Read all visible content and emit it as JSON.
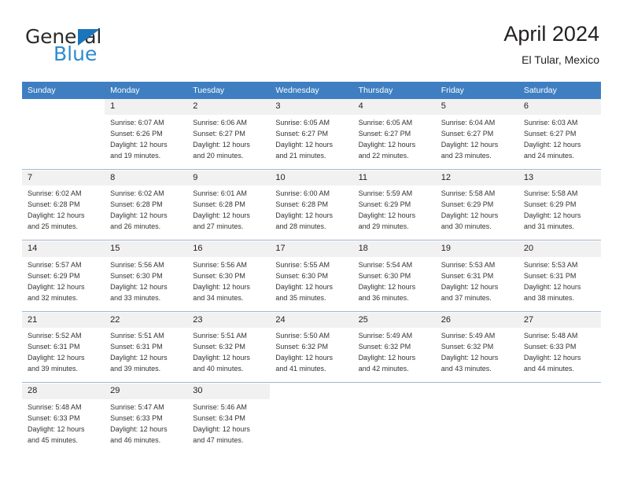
{
  "brand": {
    "name_part1": "General",
    "name_part2": "Blue",
    "accent_color": "#1b75bb",
    "accent_color_light": "#2e8bd0",
    "triangle_icon": "triangle-icon"
  },
  "header": {
    "title": "April 2024",
    "subtitle": "El Tular, Mexico"
  },
  "theme": {
    "header_row_bg": "#3f7fc1",
    "daynum_band_bg": "#f1f1f1",
    "separator_color": "#9fb6cd",
    "text_color": "#231f20"
  },
  "calendar": {
    "weekday_headers": [
      "Sunday",
      "Monday",
      "Tuesday",
      "Wednesday",
      "Thursday",
      "Friday",
      "Saturday"
    ],
    "labels": {
      "sunrise": "Sunrise:",
      "sunset": "Sunset:",
      "daylight": "Daylight:"
    },
    "weeks": [
      {
        "days": [
          {
            "num": "",
            "sunrise": "",
            "sunset": "",
            "daylight_line1": "",
            "daylight_line2": "",
            "empty": true
          },
          {
            "num": "1",
            "sunrise": "Sunrise: 6:07 AM",
            "sunset": "Sunset: 6:26 PM",
            "daylight_line1": "Daylight: 12 hours",
            "daylight_line2": "and 19 minutes."
          },
          {
            "num": "2",
            "sunrise": "Sunrise: 6:06 AM",
            "sunset": "Sunset: 6:27 PM",
            "daylight_line1": "Daylight: 12 hours",
            "daylight_line2": "and 20 minutes."
          },
          {
            "num": "3",
            "sunrise": "Sunrise: 6:05 AM",
            "sunset": "Sunset: 6:27 PM",
            "daylight_line1": "Daylight: 12 hours",
            "daylight_line2": "and 21 minutes."
          },
          {
            "num": "4",
            "sunrise": "Sunrise: 6:05 AM",
            "sunset": "Sunset: 6:27 PM",
            "daylight_line1": "Daylight: 12 hours",
            "daylight_line2": "and 22 minutes."
          },
          {
            "num": "5",
            "sunrise": "Sunrise: 6:04 AM",
            "sunset": "Sunset: 6:27 PM",
            "daylight_line1": "Daylight: 12 hours",
            "daylight_line2": "and 23 minutes."
          },
          {
            "num": "6",
            "sunrise": "Sunrise: 6:03 AM",
            "sunset": "Sunset: 6:27 PM",
            "daylight_line1": "Daylight: 12 hours",
            "daylight_line2": "and 24 minutes."
          }
        ]
      },
      {
        "days": [
          {
            "num": "7",
            "sunrise": "Sunrise: 6:02 AM",
            "sunset": "Sunset: 6:28 PM",
            "daylight_line1": "Daylight: 12 hours",
            "daylight_line2": "and 25 minutes."
          },
          {
            "num": "8",
            "sunrise": "Sunrise: 6:02 AM",
            "sunset": "Sunset: 6:28 PM",
            "daylight_line1": "Daylight: 12 hours",
            "daylight_line2": "and 26 minutes."
          },
          {
            "num": "9",
            "sunrise": "Sunrise: 6:01 AM",
            "sunset": "Sunset: 6:28 PM",
            "daylight_line1": "Daylight: 12 hours",
            "daylight_line2": "and 27 minutes."
          },
          {
            "num": "10",
            "sunrise": "Sunrise: 6:00 AM",
            "sunset": "Sunset: 6:28 PM",
            "daylight_line1": "Daylight: 12 hours",
            "daylight_line2": "and 28 minutes."
          },
          {
            "num": "11",
            "sunrise": "Sunrise: 5:59 AM",
            "sunset": "Sunset: 6:29 PM",
            "daylight_line1": "Daylight: 12 hours",
            "daylight_line2": "and 29 minutes."
          },
          {
            "num": "12",
            "sunrise": "Sunrise: 5:58 AM",
            "sunset": "Sunset: 6:29 PM",
            "daylight_line1": "Daylight: 12 hours",
            "daylight_line2": "and 30 minutes."
          },
          {
            "num": "13",
            "sunrise": "Sunrise: 5:58 AM",
            "sunset": "Sunset: 6:29 PM",
            "daylight_line1": "Daylight: 12 hours",
            "daylight_line2": "and 31 minutes."
          }
        ]
      },
      {
        "days": [
          {
            "num": "14",
            "sunrise": "Sunrise: 5:57 AM",
            "sunset": "Sunset: 6:29 PM",
            "daylight_line1": "Daylight: 12 hours",
            "daylight_line2": "and 32 minutes."
          },
          {
            "num": "15",
            "sunrise": "Sunrise: 5:56 AM",
            "sunset": "Sunset: 6:30 PM",
            "daylight_line1": "Daylight: 12 hours",
            "daylight_line2": "and 33 minutes."
          },
          {
            "num": "16",
            "sunrise": "Sunrise: 5:56 AM",
            "sunset": "Sunset: 6:30 PM",
            "daylight_line1": "Daylight: 12 hours",
            "daylight_line2": "and 34 minutes."
          },
          {
            "num": "17",
            "sunrise": "Sunrise: 5:55 AM",
            "sunset": "Sunset: 6:30 PM",
            "daylight_line1": "Daylight: 12 hours",
            "daylight_line2": "and 35 minutes."
          },
          {
            "num": "18",
            "sunrise": "Sunrise: 5:54 AM",
            "sunset": "Sunset: 6:30 PM",
            "daylight_line1": "Daylight: 12 hours",
            "daylight_line2": "and 36 minutes."
          },
          {
            "num": "19",
            "sunrise": "Sunrise: 5:53 AM",
            "sunset": "Sunset: 6:31 PM",
            "daylight_line1": "Daylight: 12 hours",
            "daylight_line2": "and 37 minutes."
          },
          {
            "num": "20",
            "sunrise": "Sunrise: 5:53 AM",
            "sunset": "Sunset: 6:31 PM",
            "daylight_line1": "Daylight: 12 hours",
            "daylight_line2": "and 38 minutes."
          }
        ]
      },
      {
        "days": [
          {
            "num": "21",
            "sunrise": "Sunrise: 5:52 AM",
            "sunset": "Sunset: 6:31 PM",
            "daylight_line1": "Daylight: 12 hours",
            "daylight_line2": "and 39 minutes."
          },
          {
            "num": "22",
            "sunrise": "Sunrise: 5:51 AM",
            "sunset": "Sunset: 6:31 PM",
            "daylight_line1": "Daylight: 12 hours",
            "daylight_line2": "and 39 minutes."
          },
          {
            "num": "23",
            "sunrise": "Sunrise: 5:51 AM",
            "sunset": "Sunset: 6:32 PM",
            "daylight_line1": "Daylight: 12 hours",
            "daylight_line2": "and 40 minutes."
          },
          {
            "num": "24",
            "sunrise": "Sunrise: 5:50 AM",
            "sunset": "Sunset: 6:32 PM",
            "daylight_line1": "Daylight: 12 hours",
            "daylight_line2": "and 41 minutes."
          },
          {
            "num": "25",
            "sunrise": "Sunrise: 5:49 AM",
            "sunset": "Sunset: 6:32 PM",
            "daylight_line1": "Daylight: 12 hours",
            "daylight_line2": "and 42 minutes."
          },
          {
            "num": "26",
            "sunrise": "Sunrise: 5:49 AM",
            "sunset": "Sunset: 6:32 PM",
            "daylight_line1": "Daylight: 12 hours",
            "daylight_line2": "and 43 minutes."
          },
          {
            "num": "27",
            "sunrise": "Sunrise: 5:48 AM",
            "sunset": "Sunset: 6:33 PM",
            "daylight_line1": "Daylight: 12 hours",
            "daylight_line2": "and 44 minutes."
          }
        ]
      },
      {
        "days": [
          {
            "num": "28",
            "sunrise": "Sunrise: 5:48 AM",
            "sunset": "Sunset: 6:33 PM",
            "daylight_line1": "Daylight: 12 hours",
            "daylight_line2": "and 45 minutes."
          },
          {
            "num": "29",
            "sunrise": "Sunrise: 5:47 AM",
            "sunset": "Sunset: 6:33 PM",
            "daylight_line1": "Daylight: 12 hours",
            "daylight_line2": "and 46 minutes."
          },
          {
            "num": "30",
            "sunrise": "Sunrise: 5:46 AM",
            "sunset": "Sunset: 6:34 PM",
            "daylight_line1": "Daylight: 12 hours",
            "daylight_line2": "and 47 minutes."
          },
          {
            "num": "",
            "sunrise": "",
            "sunset": "",
            "daylight_line1": "",
            "daylight_line2": "",
            "empty": true
          },
          {
            "num": "",
            "sunrise": "",
            "sunset": "",
            "daylight_line1": "",
            "daylight_line2": "",
            "empty": true
          },
          {
            "num": "",
            "sunrise": "",
            "sunset": "",
            "daylight_line1": "",
            "daylight_line2": "",
            "empty": true
          },
          {
            "num": "",
            "sunrise": "",
            "sunset": "",
            "daylight_line1": "",
            "daylight_line2": "",
            "empty": true
          }
        ]
      }
    ]
  }
}
